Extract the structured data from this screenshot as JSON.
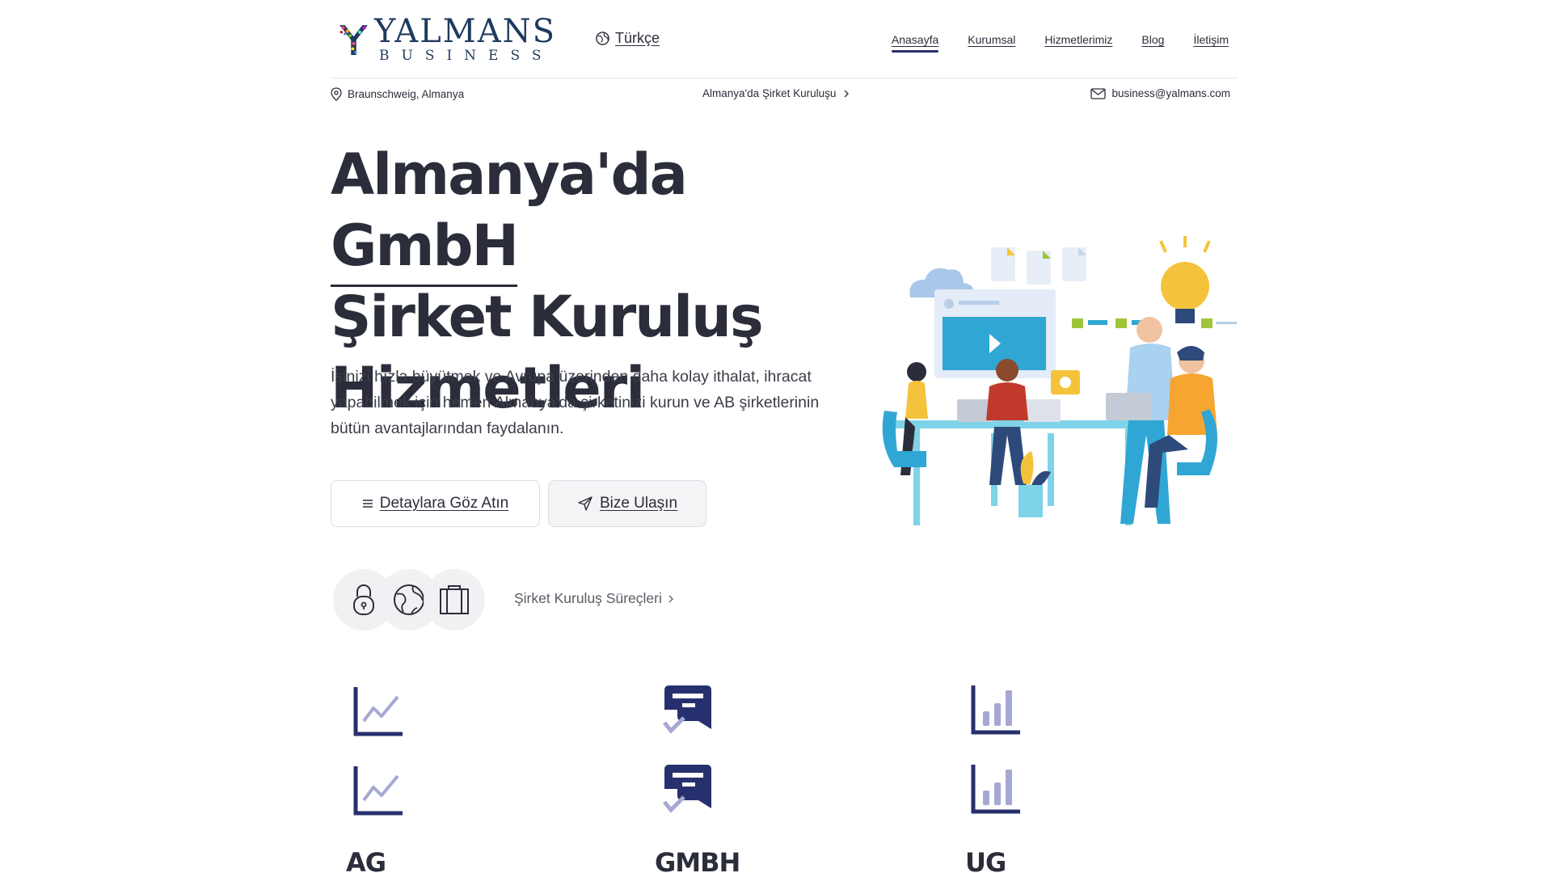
{
  "header": {
    "logo": {
      "name": "YALMANS",
      "sub": "BUSINESS"
    },
    "language": "Türkçe",
    "nav": [
      "Anasayfa",
      "Kurumsal",
      "Hizmetlerimiz",
      "Blog",
      "İletişim"
    ],
    "active_nav": "Anasayfa"
  },
  "subbar": {
    "location": "Braunschweig, Almanya",
    "breadcrumb": "Almanya'da Şirket Kuruluşu",
    "email": "business@yalmans.com"
  },
  "hero": {
    "title_part1": "Almanya'da ",
    "title_highlight": "GmbH",
    "title_line2": "Şirket Kuruluş",
    "title_line3": "Hizmetleri",
    "lead": "İşinizi hızla büyütmek ve Avrupa üzerinden daha kolay ithalat, ihracat yapabilmek için hemen Almanya'da şirketinizi kurun ve AB şirketlerinin bütün avantajlarından faydalanın.",
    "button_details": "Detaylara Göz Atın",
    "button_contact": "Bize Ulaşın",
    "process_link": "Şirket Kuruluş Süreçleri"
  },
  "icons": {
    "lock": "lock-icon",
    "globe": "globe-icon",
    "briefcase": "briefcase-icon",
    "line_chart": "line-chart-icon",
    "chat_check": "chat-check-icon",
    "bar_chart": "bar-chart-icon"
  },
  "company_types": [
    "AG",
    "GMBH",
    "UG"
  ],
  "colors": {
    "accent": "#27306e",
    "icon_light": "#a6a8d4",
    "text": "#2b2d3a"
  }
}
